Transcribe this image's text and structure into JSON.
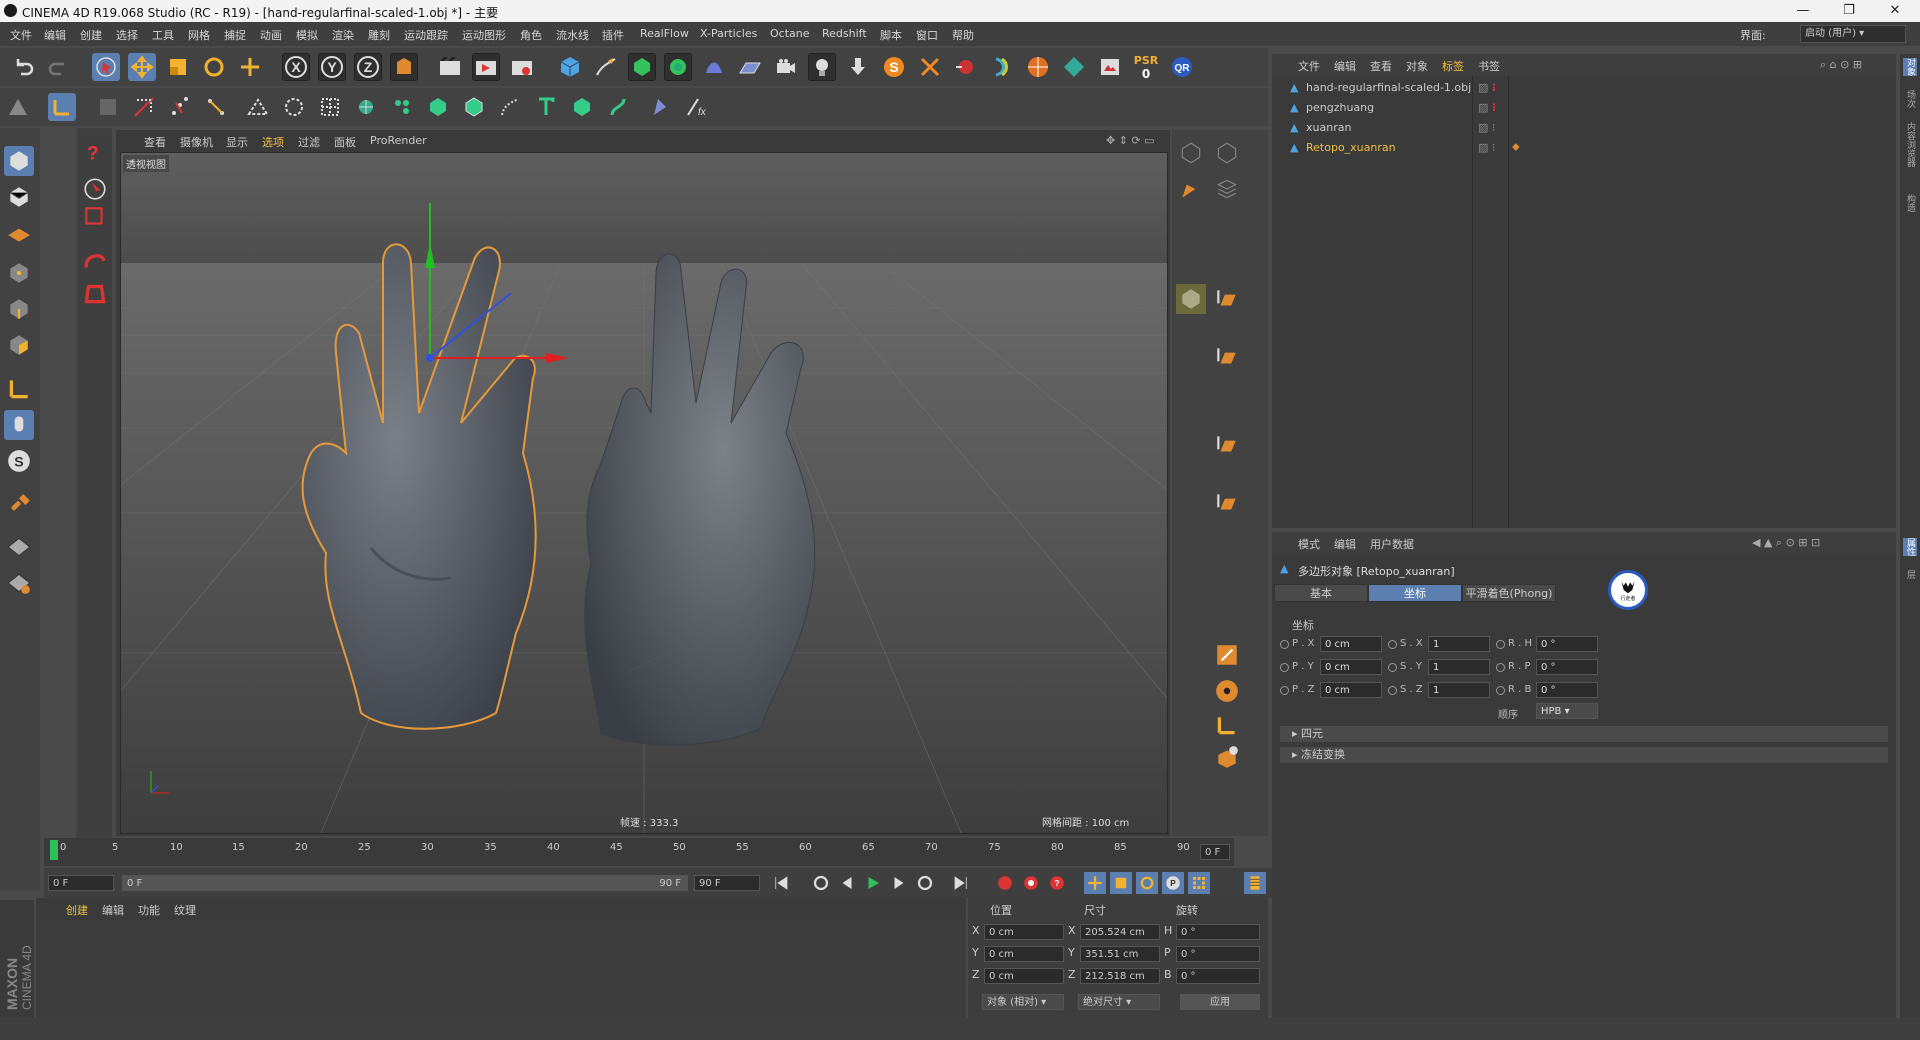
{
  "titlebar": {
    "title": "CINEMA 4D R19.068 Studio (RC - R19) - [hand-regularfinal-scaled-1.obj *] - 主要",
    "min": "—",
    "max": "❐",
    "close": "✕"
  },
  "menubar": {
    "items": [
      "文件",
      "编辑",
      "创建",
      "选择",
      "工具",
      "网格",
      "捕捉",
      "动画",
      "模拟",
      "渲染",
      "雕刻",
      "运动跟踪",
      "运动图形",
      "角色",
      "流水线",
      "插件",
      "RealFlow",
      "X-Particles",
      "Octane",
      "Redshift",
      "脚本",
      "窗口",
      "帮助"
    ],
    "layout_label": "界面:",
    "layout_value": "启动 (用户)"
  },
  "colors": {
    "accent": "#5a7fb0",
    "selection_outline": "#e59a3a",
    "x_axis": "#e02020",
    "y_axis": "#20c020",
    "z_axis": "#3050e0",
    "highlight_text": "#f0c040"
  },
  "toolbar": {
    "psr_label": "PSR",
    "psr_value": "0",
    "qr_label": "QR"
  },
  "viewport": {
    "menu": [
      "查看",
      "摄像机",
      "显示",
      "选项",
      "过滤",
      "面板",
      "ProRender"
    ],
    "label": "透视视图",
    "fps": "帧速 : 333.3",
    "grid_spacing": "网格间距 : 100 cm"
  },
  "timeline": {
    "ticks": [
      "0",
      "5",
      "10",
      "15",
      "20",
      "25",
      "30",
      "35",
      "40",
      "45",
      "50",
      "55",
      "60",
      "65",
      "70",
      "75",
      "80",
      "85",
      "90"
    ],
    "current": "0 F"
  },
  "playbar": {
    "start": "0 F",
    "range_start": "0 F",
    "range_end": "90 F",
    "end": "90 F"
  },
  "material": {
    "menu": [
      "创建",
      "编辑",
      "功能",
      "纹理"
    ]
  },
  "coords": {
    "headers": [
      "位置",
      "尺寸",
      "旋转"
    ],
    "rows": [
      {
        "axis": "X",
        "pos": "0 cm",
        "size_axis": "X",
        "size": "205.524 cm",
        "rot_axis": "H",
        "rot": "0 °"
      },
      {
        "axis": "Y",
        "pos": "0 cm",
        "size_axis": "Y",
        "size": "351.51 cm",
        "rot_axis": "P",
        "rot": "0 °"
      },
      {
        "axis": "Z",
        "pos": "0 cm",
        "size_axis": "Z",
        "size": "212.518 cm",
        "rot_axis": "B",
        "rot": "0 °"
      }
    ],
    "mode": "对象 (相对)",
    "size_mode": "绝对尺寸",
    "apply": "应用"
  },
  "objects": {
    "menu": [
      "文件",
      "编辑",
      "查看",
      "对象",
      "标签",
      "书签"
    ],
    "items": [
      {
        "name": "hand-regularfinal-scaled-1.obj"
      },
      {
        "name": "pengzhuang"
      },
      {
        "name": "xuanran"
      },
      {
        "name": "Retopo_xuanran",
        "active": true
      }
    ]
  },
  "attributes": {
    "menu": [
      "模式",
      "编辑",
      "用户数据"
    ],
    "title": "多边形对象 [Retopo_xuanran]",
    "tabs": [
      "基本",
      "坐标",
      "平滑着色(Phong)"
    ],
    "active_tab": "坐标",
    "section": "坐标",
    "rows": [
      {
        "p": "P . X",
        "pv": "0 cm",
        "s": "S . X",
        "sv": "1",
        "r": "R . H",
        "rv": "0 °"
      },
      {
        "p": "P . Y",
        "pv": "0 cm",
        "s": "S . Y",
        "sv": "1",
        "r": "R . P",
        "rv": "0 °"
      },
      {
        "p": "P . Z",
        "pv": "0 cm",
        "s": "S . Z",
        "sv": "1",
        "r": "R . B",
        "rv": "0 °"
      }
    ],
    "order_label": "顺序",
    "order_value": "HPB",
    "collapsed": [
      "四元",
      "冻结变换"
    ],
    "badge": "行走者"
  },
  "vtabs": [
    "对象",
    "场次",
    "内容浏览器",
    "构造",
    "属性",
    "层"
  ],
  "brand": {
    "line1": "MAXON",
    "line2": "CINEMA 4D"
  }
}
